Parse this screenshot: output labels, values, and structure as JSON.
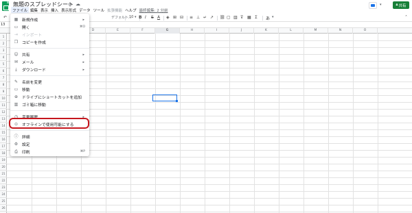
{
  "app": {
    "title": "無題のスプレッドシート",
    "share_label": "共有"
  },
  "menubar": [
    {
      "label": "ファイル",
      "state": "active"
    },
    {
      "label": "編集",
      "state": "normal"
    },
    {
      "label": "表示",
      "state": "normal"
    },
    {
      "label": "挿入",
      "state": "normal"
    },
    {
      "label": "表示形式",
      "state": "normal"
    },
    {
      "label": "データ",
      "state": "normal"
    },
    {
      "label": "ツール",
      "state": "normal"
    },
    {
      "label": "拡張機能",
      "state": "faded"
    },
    {
      "label": "ヘルプ",
      "state": "normal"
    },
    {
      "label": "最終編集: 2 分前",
      "state": "link"
    }
  ],
  "toolbar": {
    "undo": "↶",
    "font_name": "デフォルト...",
    "font_size": "10",
    "bold": "B",
    "italic": "I",
    "strike": "S",
    "text_color": "A"
  },
  "formula_bar": {
    "cell_ref": "13"
  },
  "columns": [
    "A",
    "B",
    "C",
    "D",
    "E",
    "F",
    "G",
    "H",
    "I",
    "J",
    "K",
    "L",
    "M",
    "N",
    "O"
  ],
  "selected_column": "G",
  "file_menu": {
    "items": [
      {
        "label": "新規作成",
        "icon": "new-sheet-icon",
        "glyph": "▦",
        "shortcut": "",
        "submenu": true,
        "disabled": false
      },
      {
        "label": "開く",
        "icon": "folder-icon",
        "glyph": "▭",
        "shortcut": "⌘O",
        "submenu": false,
        "disabled": false
      },
      {
        "label": "インポート",
        "icon": "import-icon",
        "glyph": "⇥",
        "shortcut": "",
        "submenu": false,
        "disabled": true
      },
      {
        "label": "コピーを作成",
        "icon": "copy-icon",
        "glyph": "❐",
        "shortcut": "",
        "submenu": false,
        "disabled": false
      },
      {
        "label": "共有",
        "icon": "share-person-icon",
        "glyph": "☺",
        "shortcut": "",
        "submenu": true,
        "disabled": false
      },
      {
        "label": "メール",
        "icon": "mail-icon",
        "glyph": "✉",
        "shortcut": "",
        "submenu": true,
        "disabled": false
      },
      {
        "label": "ダウンロード",
        "icon": "download-icon",
        "glyph": "⤓",
        "shortcut": "",
        "submenu": true,
        "disabled": false
      },
      {
        "label": "名前を変更",
        "icon": "rename-pencil-icon",
        "glyph": "✎",
        "shortcut": "",
        "submenu": false,
        "disabled": false
      },
      {
        "label": "移動",
        "icon": "move-folder-icon",
        "glyph": "▭",
        "shortcut": "",
        "submenu": false,
        "disabled": false
      },
      {
        "label": "ドライブにショートカットを追加",
        "icon": "drive-shortcut-icon",
        "glyph": "⊕",
        "shortcut": "",
        "submenu": false,
        "disabled": false
      },
      {
        "label": "ゴミ箱に移動",
        "icon": "trash-icon",
        "glyph": "▥",
        "shortcut": "",
        "submenu": false,
        "disabled": false
      },
      {
        "label": "変更履歴",
        "icon": "history-icon",
        "glyph": "◷",
        "shortcut": "",
        "submenu": true,
        "disabled": false
      },
      {
        "label": "オフラインで使用可能にする",
        "icon": "offline-icon",
        "glyph": "⊙",
        "shortcut": "",
        "submenu": false,
        "disabled": false
      },
      {
        "label": "詳細",
        "icon": "info-icon",
        "glyph": "ⓘ",
        "shortcut": "",
        "submenu": false,
        "disabled": false
      },
      {
        "label": "設定",
        "icon": "settings-gear-icon",
        "glyph": "⚙",
        "shortcut": "",
        "submenu": false,
        "disabled": false
      },
      {
        "label": "印刷",
        "icon": "print-icon",
        "glyph": "⎙",
        "shortcut": "⌘P",
        "submenu": false,
        "disabled": false
      }
    ]
  },
  "colors": {
    "share_green": "#188038",
    "highlight_red": "#c5161d",
    "selection_blue": "#1a73e8"
  }
}
